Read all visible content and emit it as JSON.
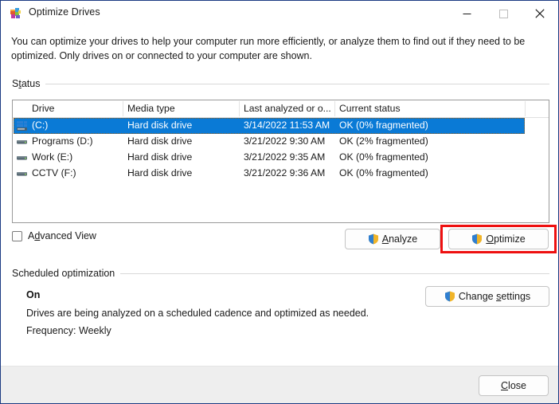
{
  "window": {
    "title": "Optimize Drives",
    "icon": "optimize-drives-icon",
    "controls": {
      "minimize": "minimize-icon",
      "maximize": "maximize-icon",
      "close": "close-icon"
    },
    "border_color": "#1b3a82"
  },
  "intro": "You can optimize your drives to help your computer run more efficiently, or analyze them to find out if they need to be optimized. Only drives on or connected to your computer are shown.",
  "status_group": {
    "label": "Status",
    "accelerator": "t"
  },
  "table": {
    "columns": [
      "Drive",
      "Media type",
      "Last analyzed or o...",
      "Current status"
    ],
    "rows": [
      {
        "icon": "system-drive-icon",
        "drive": "(C:)",
        "media_type": "Hard disk drive",
        "last_analyzed": "3/14/2022 11:53 AM",
        "current_status": "OK (0% fragmented)",
        "selected": true
      },
      {
        "icon": "hard-disk-icon",
        "drive": "Programs (D:)",
        "media_type": "Hard disk drive",
        "last_analyzed": "3/21/2022 9:30 AM",
        "current_status": "OK (2% fragmented)",
        "selected": false
      },
      {
        "icon": "hard-disk-icon",
        "drive": "Work (E:)",
        "media_type": "Hard disk drive",
        "last_analyzed": "3/21/2022 9:35 AM",
        "current_status": "OK (0% fragmented)",
        "selected": false
      },
      {
        "icon": "hard-disk-icon",
        "drive": "CCTV (F:)",
        "media_type": "Hard disk drive",
        "last_analyzed": "3/21/2022 9:36 AM",
        "current_status": "OK (0% fragmented)",
        "selected": false
      }
    ],
    "selection_color": "#0a7ad6"
  },
  "advanced_view": {
    "label": "Advanced View",
    "checked": false
  },
  "buttons": {
    "analyze": "Analyze",
    "optimize": "Optimize",
    "change_settings": "Change settings",
    "close": "Close"
  },
  "highlight": {
    "target": "optimize-button",
    "color": "#ee1010"
  },
  "scheduled": {
    "label": "Scheduled optimization",
    "state": "On",
    "description": "Drives are being analyzed on a scheduled cadence and optimized as needed.",
    "frequency": "Frequency: Weekly"
  }
}
